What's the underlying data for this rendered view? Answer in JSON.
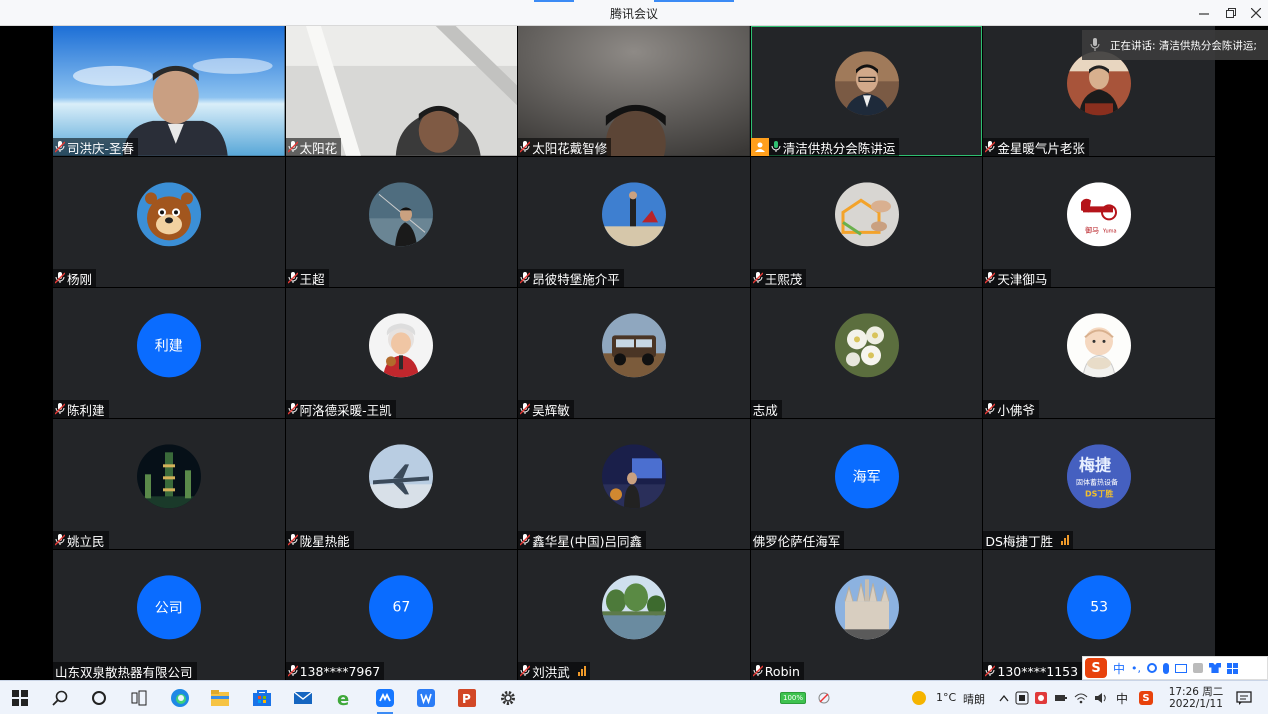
{
  "window": {
    "title": "腾讯会议"
  },
  "speaking": {
    "label": "正在讲话: 清洁供热分会陈讲运;"
  },
  "participants": [
    {
      "name": "司洪庆-圣春",
      "type": "video"
    },
    {
      "name": "太阳花",
      "type": "video"
    },
    {
      "name": "太阳花戴智修",
      "type": "video"
    },
    {
      "name": "清洁供热分会陈讲运",
      "type": "photo",
      "host": true,
      "active": true
    },
    {
      "name": "金星暖气片老张",
      "type": "photo"
    },
    {
      "name": "杨刚",
      "type": "photo"
    },
    {
      "name": "王超",
      "type": "photo"
    },
    {
      "name": "昂彼特堡施介平",
      "type": "photo"
    },
    {
      "name": "王熙茂",
      "type": "photo"
    },
    {
      "name": "天津御马",
      "type": "photo",
      "logo_text": "Yuma"
    },
    {
      "name": "陈利建",
      "type": "text",
      "avatar_text": "利建"
    },
    {
      "name": "阿洛德采暖-王凯",
      "type": "photo"
    },
    {
      "name": "吴辉敏",
      "type": "photo"
    },
    {
      "name": "志成",
      "type": "photo",
      "no_mic": true
    },
    {
      "name": "小佛爷",
      "type": "photo"
    },
    {
      "name": "姚立民",
      "type": "photo"
    },
    {
      "name": "陇星热能",
      "type": "photo"
    },
    {
      "name": "鑫华星(中国)吕同鑫",
      "type": "photo"
    },
    {
      "name": "佛罗伦萨任海军",
      "type": "text",
      "avatar_text": "海军",
      "no_mic": true
    },
    {
      "name": "DS梅捷丁胜",
      "type": "photo",
      "no_mic": true,
      "signal": true,
      "logo_text": "梅捷"
    },
    {
      "name": "山东双泉散热器有限公司",
      "type": "text",
      "avatar_text": "公司",
      "no_mic": true
    },
    {
      "name": "138****7967",
      "type": "text",
      "avatar_text": "67"
    },
    {
      "name": "刘洪武",
      "type": "photo",
      "signal": true
    },
    {
      "name": "Robin",
      "type": "photo"
    },
    {
      "name": "130****1153",
      "type": "text",
      "avatar_text": "53"
    }
  ],
  "taskbar": {
    "battery": "100%",
    "weather": "1°C",
    "weather_desc": "晴朗",
    "ime_lang": "中",
    "time": "17:26 周二",
    "date": "2022/1/11"
  },
  "colors": {
    "tile_bg": "#232528",
    "avatar_blue": "#0a6cff",
    "active_border": "#2fbf71",
    "host_badge": "#ff9f1c"
  }
}
